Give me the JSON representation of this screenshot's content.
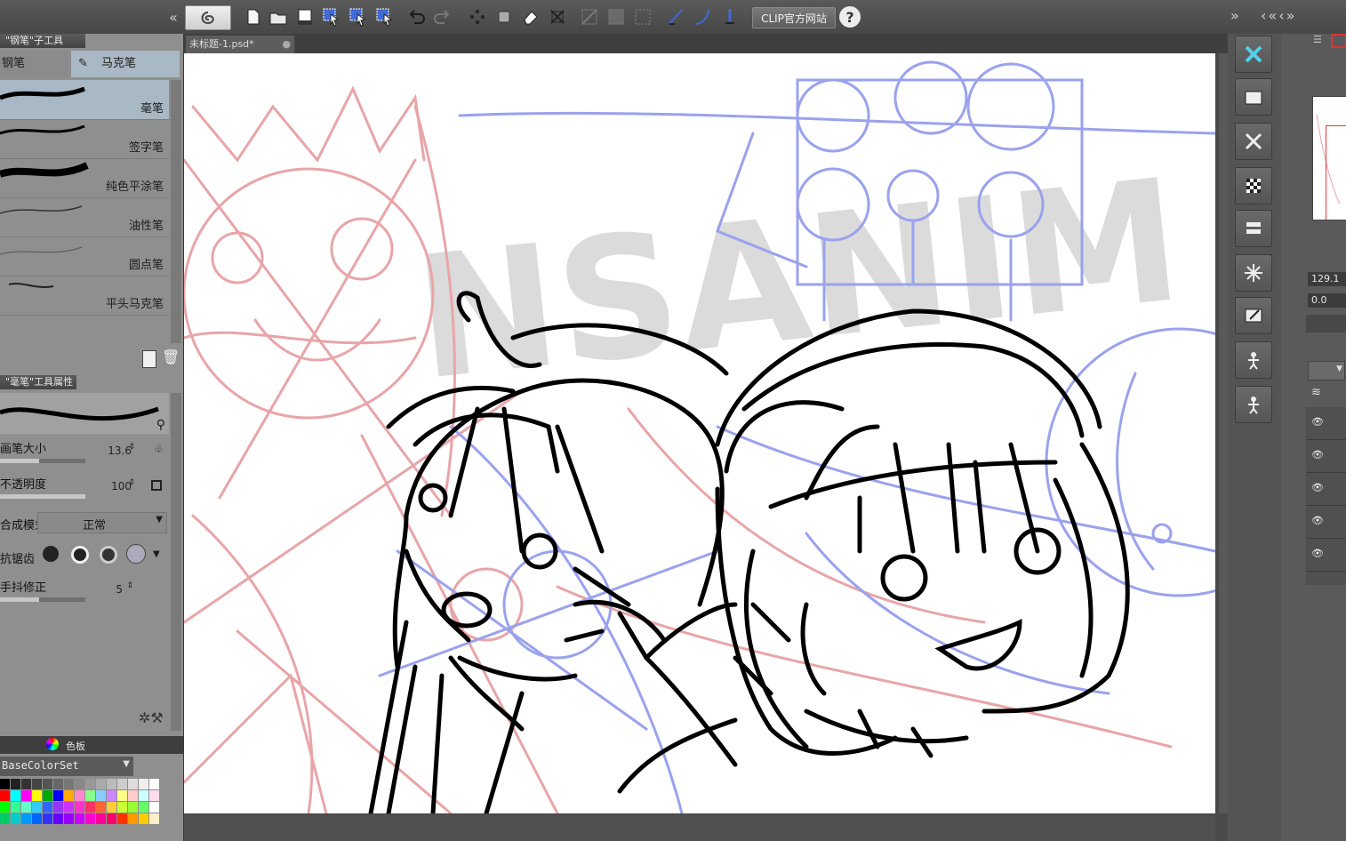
{
  "toolbar": {
    "clip_site_label": "CLIP官方网站",
    "help_label": "?"
  },
  "subtool_panel": {
    "title": "\"钢笔\"子工具",
    "tabs": [
      {
        "label": "钢笔"
      },
      {
        "label": "马克笔"
      }
    ],
    "brushes": [
      {
        "label": "毫笔",
        "selected": true
      },
      {
        "label": "签字笔",
        "selected": false
      },
      {
        "label": "纯色平涂笔",
        "selected": false
      },
      {
        "label": "油性笔",
        "selected": false
      },
      {
        "label": "圆点笔",
        "selected": false
      },
      {
        "label": "平头马克笔",
        "selected": false
      }
    ]
  },
  "tool_property": {
    "title": "\"毫笔\"工具属性",
    "brush_size": {
      "label": "画笔大小",
      "value": "13.6",
      "fill": 0.46
    },
    "opacity": {
      "label": "不透明度",
      "value": "100",
      "fill": 1.0
    },
    "blend_mode": {
      "label": "合成模式",
      "value": "正常"
    },
    "antialias": {
      "label": "抗锯齿"
    },
    "stabilization": {
      "label": "手抖修正",
      "value": "5",
      "fill": 0.46
    }
  },
  "color_panel": {
    "tab_label": "色板",
    "color_set": "BaseColorSet"
  },
  "document": {
    "tab_title": "未标题-1.psd*"
  },
  "right_panel": {
    "zoom_value": "129.1",
    "angle_value": "0.0"
  },
  "colors": {
    "accent": "#a8b8c4",
    "sketch_red": "#e8a5a8",
    "sketch_blue": "#9aa2ee",
    "ink": "#000000"
  }
}
